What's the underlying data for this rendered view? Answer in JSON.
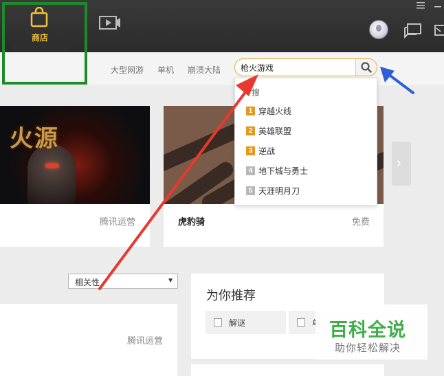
{
  "topbar": {
    "store_label": "商店",
    "icons": [
      "shopping-bag-icon",
      "video-play-icon",
      "menu-icon",
      "avatar",
      "chat-icon",
      "mail-icon"
    ]
  },
  "subnav": {
    "links": [
      "大型网游",
      "单机",
      "崩溃大陆"
    ],
    "search_value": "枪火游戏"
  },
  "search_dropdown": {
    "header": "搜",
    "items": [
      {
        "rank": "1",
        "name": "穿越火线",
        "color": "#e39a1f"
      },
      {
        "rank": "2",
        "name": "英雄联盟",
        "color": "#e39a1f"
      },
      {
        "rank": "3",
        "name": "逆战",
        "color": "#e39a1f"
      },
      {
        "rank": "4",
        "name": "地下城与勇士",
        "color": "#b8b8b8"
      },
      {
        "rank": "5",
        "name": "天涯明月刀",
        "color": "#b8b8b8"
      }
    ]
  },
  "cards": [
    {
      "banner_text": "火源",
      "publisher": "腾讯运营"
    },
    {
      "title": "虎豹骑",
      "price": "免费"
    }
  ],
  "sort": {
    "selected": "相关性"
  },
  "list_card": {
    "publisher": "腾讯运营"
  },
  "recommend": {
    "title": "为你推荐",
    "chips": [
      "解谜",
      "单"
    ]
  },
  "watermark": {
    "line1": "百科全说",
    "line2": "助你轻松解决"
  },
  "colors": {
    "accent": "#f3c23a",
    "highlight_green": "#1e8a2a",
    "arrow_red": "#e8392f",
    "arrow_blue": "#2f5fd8"
  }
}
